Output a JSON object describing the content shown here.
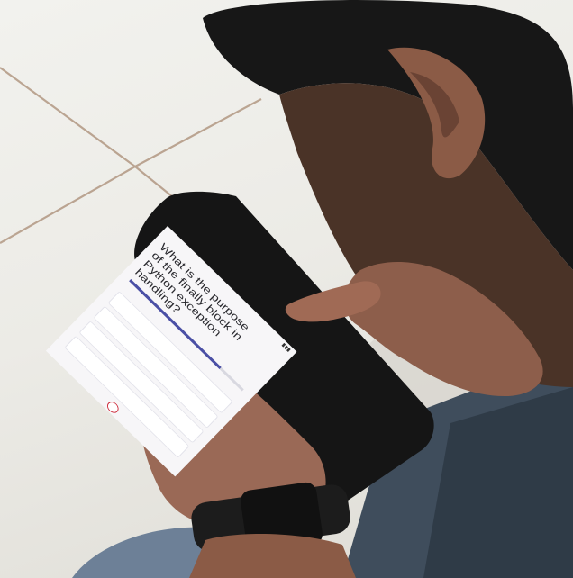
{
  "photo": {
    "subject": "person-using-smartphone"
  },
  "phone": {
    "status_right": "",
    "question": "What is the purpose of the finally block in Python exception handling?",
    "progress_percent": 80,
    "option_count": 4,
    "options": [
      "",
      "",
      "",
      ""
    ]
  },
  "colors": {
    "progress": "#4a4fa5",
    "fab_outline": "#c23"
  },
  "icons": [
    "signal-icon",
    "record-icon"
  ]
}
